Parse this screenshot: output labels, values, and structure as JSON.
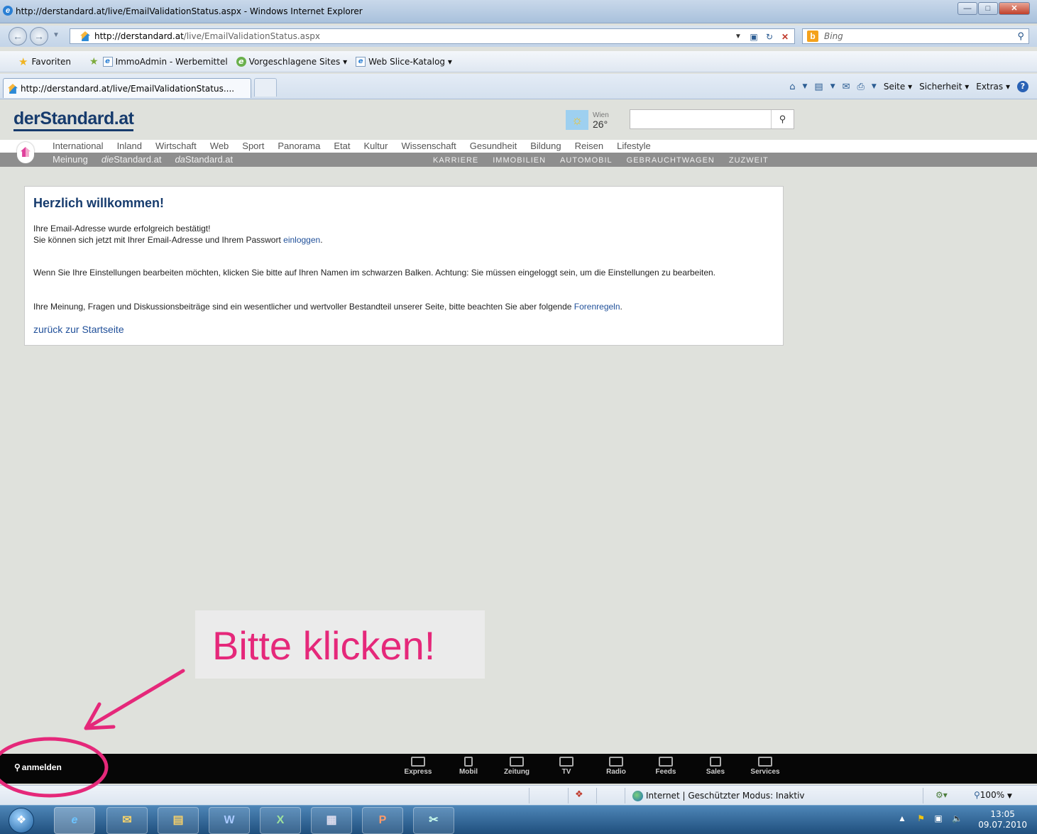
{
  "window": {
    "title": "http://derstandard.at/live/EmailValidationStatus.aspx - Windows Internet Explorer",
    "address": {
      "host": "http://derstandard.at",
      "path": "/live/EmailValidationStatus.aspx"
    },
    "search_placeholder": "Bing",
    "favorites_bar": {
      "favorites": "Favoriten",
      "items": [
        "ImmoAdmin - Werbemittel",
        "Vorgeschlagene Sites ▾",
        "Web Slice-Katalog ▾"
      ]
    },
    "tab_label": "http://derstandard.at/live/EmailValidationStatus....",
    "command_bar": {
      "page": "Seite ▾",
      "security": "Sicherheit ▾",
      "tools": "Extras ▾"
    }
  },
  "site": {
    "logo": "derStandard.at",
    "weather": {
      "city": "Wien",
      "temp": "26°"
    },
    "nav_primary": [
      "International",
      "Inland",
      "Wirtschaft",
      "Web",
      "Sport",
      "Panorama",
      "Etat",
      "Kultur",
      "Wissenschaft",
      "Gesundheit",
      "Bildung",
      "Reisen",
      "Lifestyle"
    ],
    "nav_secondary": {
      "meinung": "Meinung",
      "die_prefix": "die",
      "die_suffix": "Standard.at",
      "da_prefix": "da",
      "da_suffix": "Standard.at"
    },
    "nav_services": [
      "KARRIERE",
      "IMMOBILIEN",
      "AUTOMOBIL",
      "GEBRAUCHTWAGEN",
      "ZUZWEIT"
    ],
    "card": {
      "heading": "Herzlich willkommen!",
      "line1": "Ihre Email-Adresse wurde erfolgreich bestätigt!",
      "line2_before": "Sie können sich jetzt mit Ihrer Email-Adresse und Ihrem Passwort ",
      "line2_link": "einloggen",
      "line2_after": ".",
      "para2": "Wenn Sie Ihre Einstellungen bearbeiten möchten, klicken Sie bitte auf Ihren Namen im schwarzen Balken. Achtung: Sie müssen eingeloggt sein, um die Einstellungen zu bearbeiten.",
      "para3_before": "Ihre Meinung, Fragen und Diskussionsbeiträge sind ein wesentlicher und wertvoller Bestandteil unserer Seite, bitte beachten Sie aber folgende ",
      "para3_link": "Forenregeln",
      "para3_after": ".",
      "back_link": "zurück zur Startseite"
    },
    "bottom_bar": {
      "login": "anmelden",
      "items": [
        "Express",
        "Mobil",
        "Zeitung",
        "TV",
        "Radio",
        "Feeds",
        "Sales",
        "Services"
      ]
    }
  },
  "annotation": {
    "text": "Bitte klicken!",
    "color": "#e5287a"
  },
  "status_bar": {
    "zone": "Internet | Geschützter Modus: Inaktiv",
    "zoom": "100%"
  },
  "taskbar": {
    "time": "13:05",
    "date": "09.07.2010"
  }
}
